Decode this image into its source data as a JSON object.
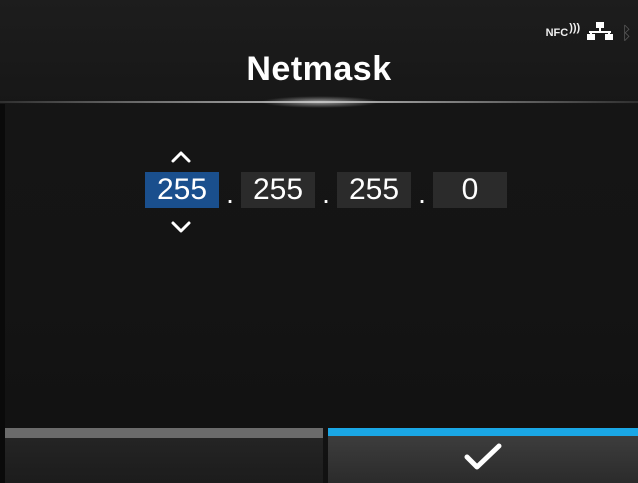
{
  "header": {
    "title": "Netmask",
    "status": {
      "nfc_label": "NFC",
      "icons": [
        "nfc-icon",
        "network-icon",
        "bluetooth-icon"
      ]
    }
  },
  "netmask": {
    "octets": [
      "255",
      "255",
      "255",
      "0"
    ],
    "separator": ".",
    "selected_index": 0
  },
  "footer": {
    "left_button": "",
    "confirm_icon": "checkmark-icon"
  },
  "colors": {
    "selected_field": "#1a4f8d",
    "accent": "#1aa7e6"
  }
}
